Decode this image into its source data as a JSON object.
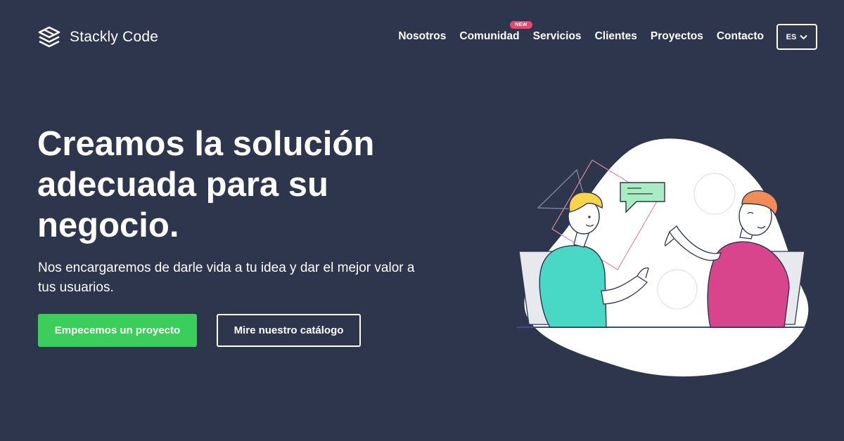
{
  "brand": {
    "name": "Stackly Code",
    "logo_icon": "stacked-layers-icon"
  },
  "nav": {
    "items": [
      {
        "label": "Nosotros"
      },
      {
        "label": "Comunidad",
        "badge": "NEW"
      },
      {
        "label": "Servicios"
      },
      {
        "label": "Clientes"
      },
      {
        "label": "Proyectos"
      },
      {
        "label": "Contacto"
      }
    ],
    "language": "ES"
  },
  "hero": {
    "title": "Creamos la solución adecuada para su negocio.",
    "subtitle": "Nos encargaremos de darle vida a tu idea y dar el mejor valor a tus usuarios.",
    "primary_button": "Empecemos un proyecto",
    "secondary_button": "Mire nuestro catálogo"
  },
  "colors": {
    "background": "#2d364c",
    "primary": "#3bce5b",
    "badge": "#e9476f",
    "person_left_shirt": "#49d8c5",
    "person_right_shirt": "#d8458c",
    "speech_bubble": "#a8ecc0"
  }
}
